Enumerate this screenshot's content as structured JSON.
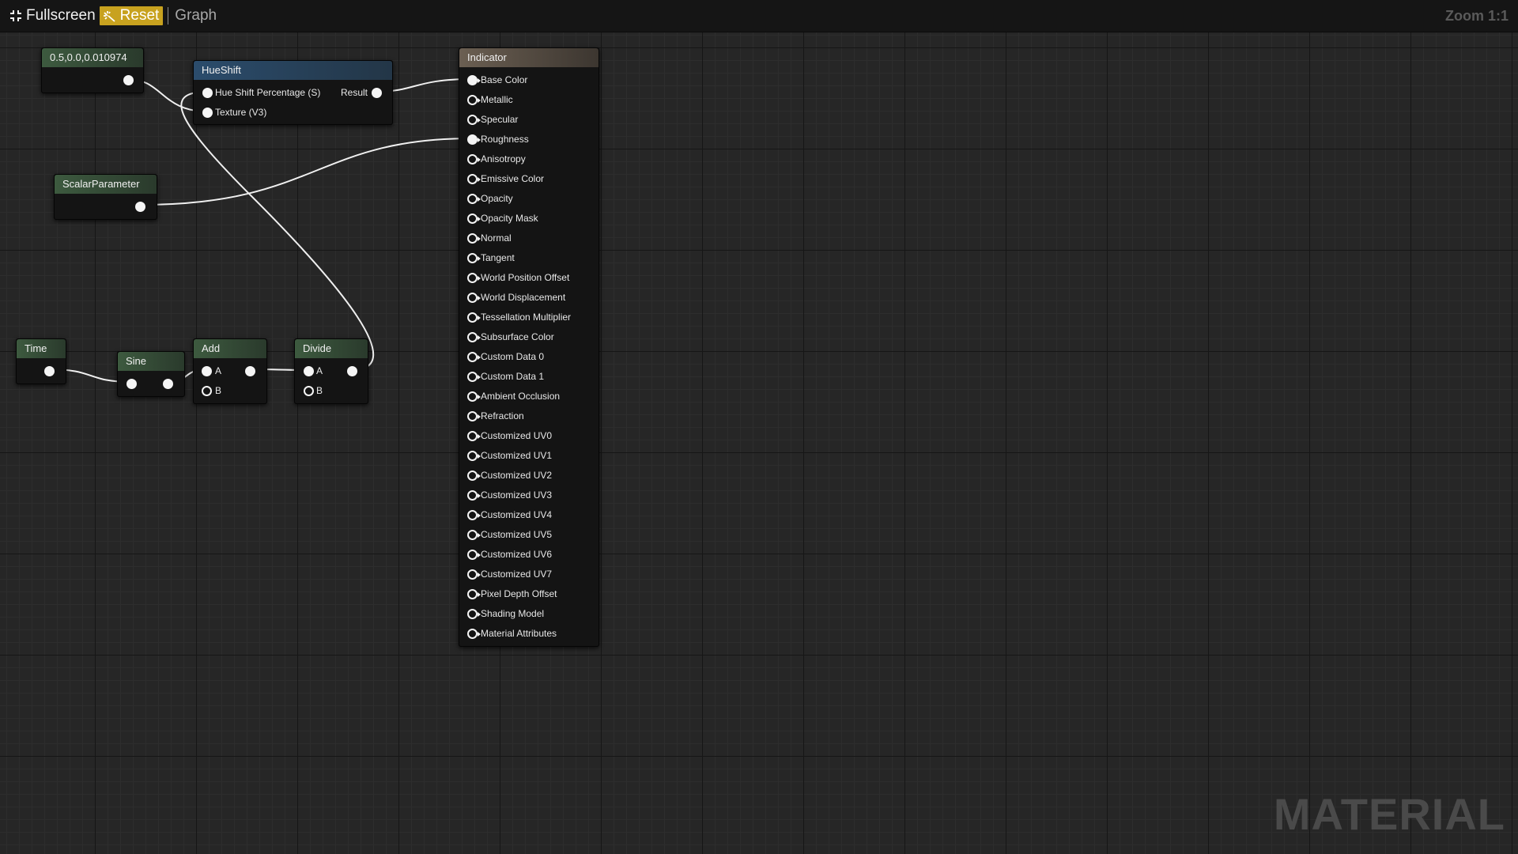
{
  "toolbar": {
    "fullscreen_label": "Fullscreen",
    "reset_label": "Reset",
    "graph_label": "Graph",
    "zoom_label": "Zoom 1:1"
  },
  "watermark": "MATERIAL",
  "colors": {
    "reset_bg": "#c8a21f",
    "header_green": "#3d5a3f",
    "header_blue": "#2b4c6c",
    "header_brown": "#6b5f52",
    "wire": "#f0f0f0"
  },
  "nodes": {
    "constant": {
      "title": "0.5,0.0,0.010974"
    },
    "hueshift": {
      "title": "HueShift",
      "in_percentage": "Hue Shift Percentage (S)",
      "in_texture": "Texture (V3)",
      "out_result": "Result"
    },
    "scalar": {
      "title": "ScalarParameter"
    },
    "time": {
      "title": "Time"
    },
    "sine": {
      "title": "Sine"
    },
    "add": {
      "title": "Add",
      "in_a": "A",
      "in_b": "B"
    },
    "divide": {
      "title": "Divide",
      "in_a": "A",
      "in_b": "B"
    },
    "indicator": {
      "title": "Indicator",
      "pins": [
        {
          "label": "Base Color",
          "connected": true
        },
        {
          "label": "Metallic",
          "connected": false
        },
        {
          "label": "Specular",
          "connected": false
        },
        {
          "label": "Roughness",
          "connected": true
        },
        {
          "label": "Anisotropy",
          "connected": false
        },
        {
          "label": "Emissive Color",
          "connected": false
        },
        {
          "label": "Opacity",
          "connected": false
        },
        {
          "label": "Opacity Mask",
          "connected": false
        },
        {
          "label": "Normal",
          "connected": false
        },
        {
          "label": "Tangent",
          "connected": false
        },
        {
          "label": "World Position Offset",
          "connected": false
        },
        {
          "label": "World Displacement",
          "connected": false
        },
        {
          "label": "Tessellation Multiplier",
          "connected": false
        },
        {
          "label": "Subsurface Color",
          "connected": false
        },
        {
          "label": "Custom Data 0",
          "connected": false
        },
        {
          "label": "Custom Data 1",
          "connected": false
        },
        {
          "label": "Ambient Occlusion",
          "connected": false
        },
        {
          "label": "Refraction",
          "connected": false
        },
        {
          "label": "Customized UV0",
          "connected": false
        },
        {
          "label": "Customized UV1",
          "connected": false
        },
        {
          "label": "Customized UV2",
          "connected": false
        },
        {
          "label": "Customized UV3",
          "connected": false
        },
        {
          "label": "Customized UV4",
          "connected": false
        },
        {
          "label": "Customized UV5",
          "connected": false
        },
        {
          "label": "Customized UV6",
          "connected": false
        },
        {
          "label": "Customized UV7",
          "connected": false
        },
        {
          "label": "Pixel Depth Offset",
          "connected": false
        },
        {
          "label": "Shading Model",
          "connected": false
        },
        {
          "label": "Material Attributes",
          "connected": false
        }
      ]
    }
  }
}
